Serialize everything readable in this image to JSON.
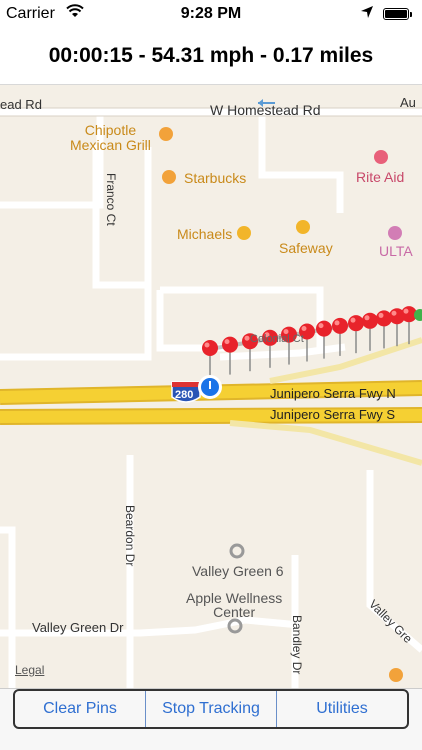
{
  "status_bar": {
    "carrier": "Carrier",
    "time": "9:28 PM"
  },
  "header": {
    "stats": "00:00:15 - 54.31 mph - 0.17 miles"
  },
  "map": {
    "roads": {
      "homestead_left": "ead Rd",
      "homestead": "W Homestead Rd",
      "homestead_right": "Au",
      "franco": "Franco Ct",
      "colonial": "Colonial Ct",
      "fwy_n": "Junipero Serra Fwy N",
      "fwy_s": "Junipero Serra Fwy S",
      "beardon": "Beardon Dr",
      "valley_green": "Valley Green Dr",
      "bandley": "Bandley Dr",
      "valley_green_right": "Valley Gre"
    },
    "pois": {
      "chipotle": "Chipotle\nMexican Grill",
      "starbucks": "Starbucks",
      "michaels": "Michaels",
      "safeway": "Safeway",
      "rite_aid": "Rite Aid",
      "ulta": "ULTA",
      "valley_green_6": "Valley Green 6",
      "apple_wellness": "Apple Wellness\nCenter"
    },
    "shield": "280",
    "legal": "Legal"
  },
  "toolbar": {
    "clear_pins": "Clear Pins",
    "stop_tracking": "Stop Tracking",
    "utilities": "Utilities"
  },
  "colors": {
    "button_text": "#2f6fd1",
    "pin_red": "#e8232b",
    "freeway": "#f5d033",
    "map_bg": "#f4efe6",
    "user_dot": "#1a73e8"
  }
}
